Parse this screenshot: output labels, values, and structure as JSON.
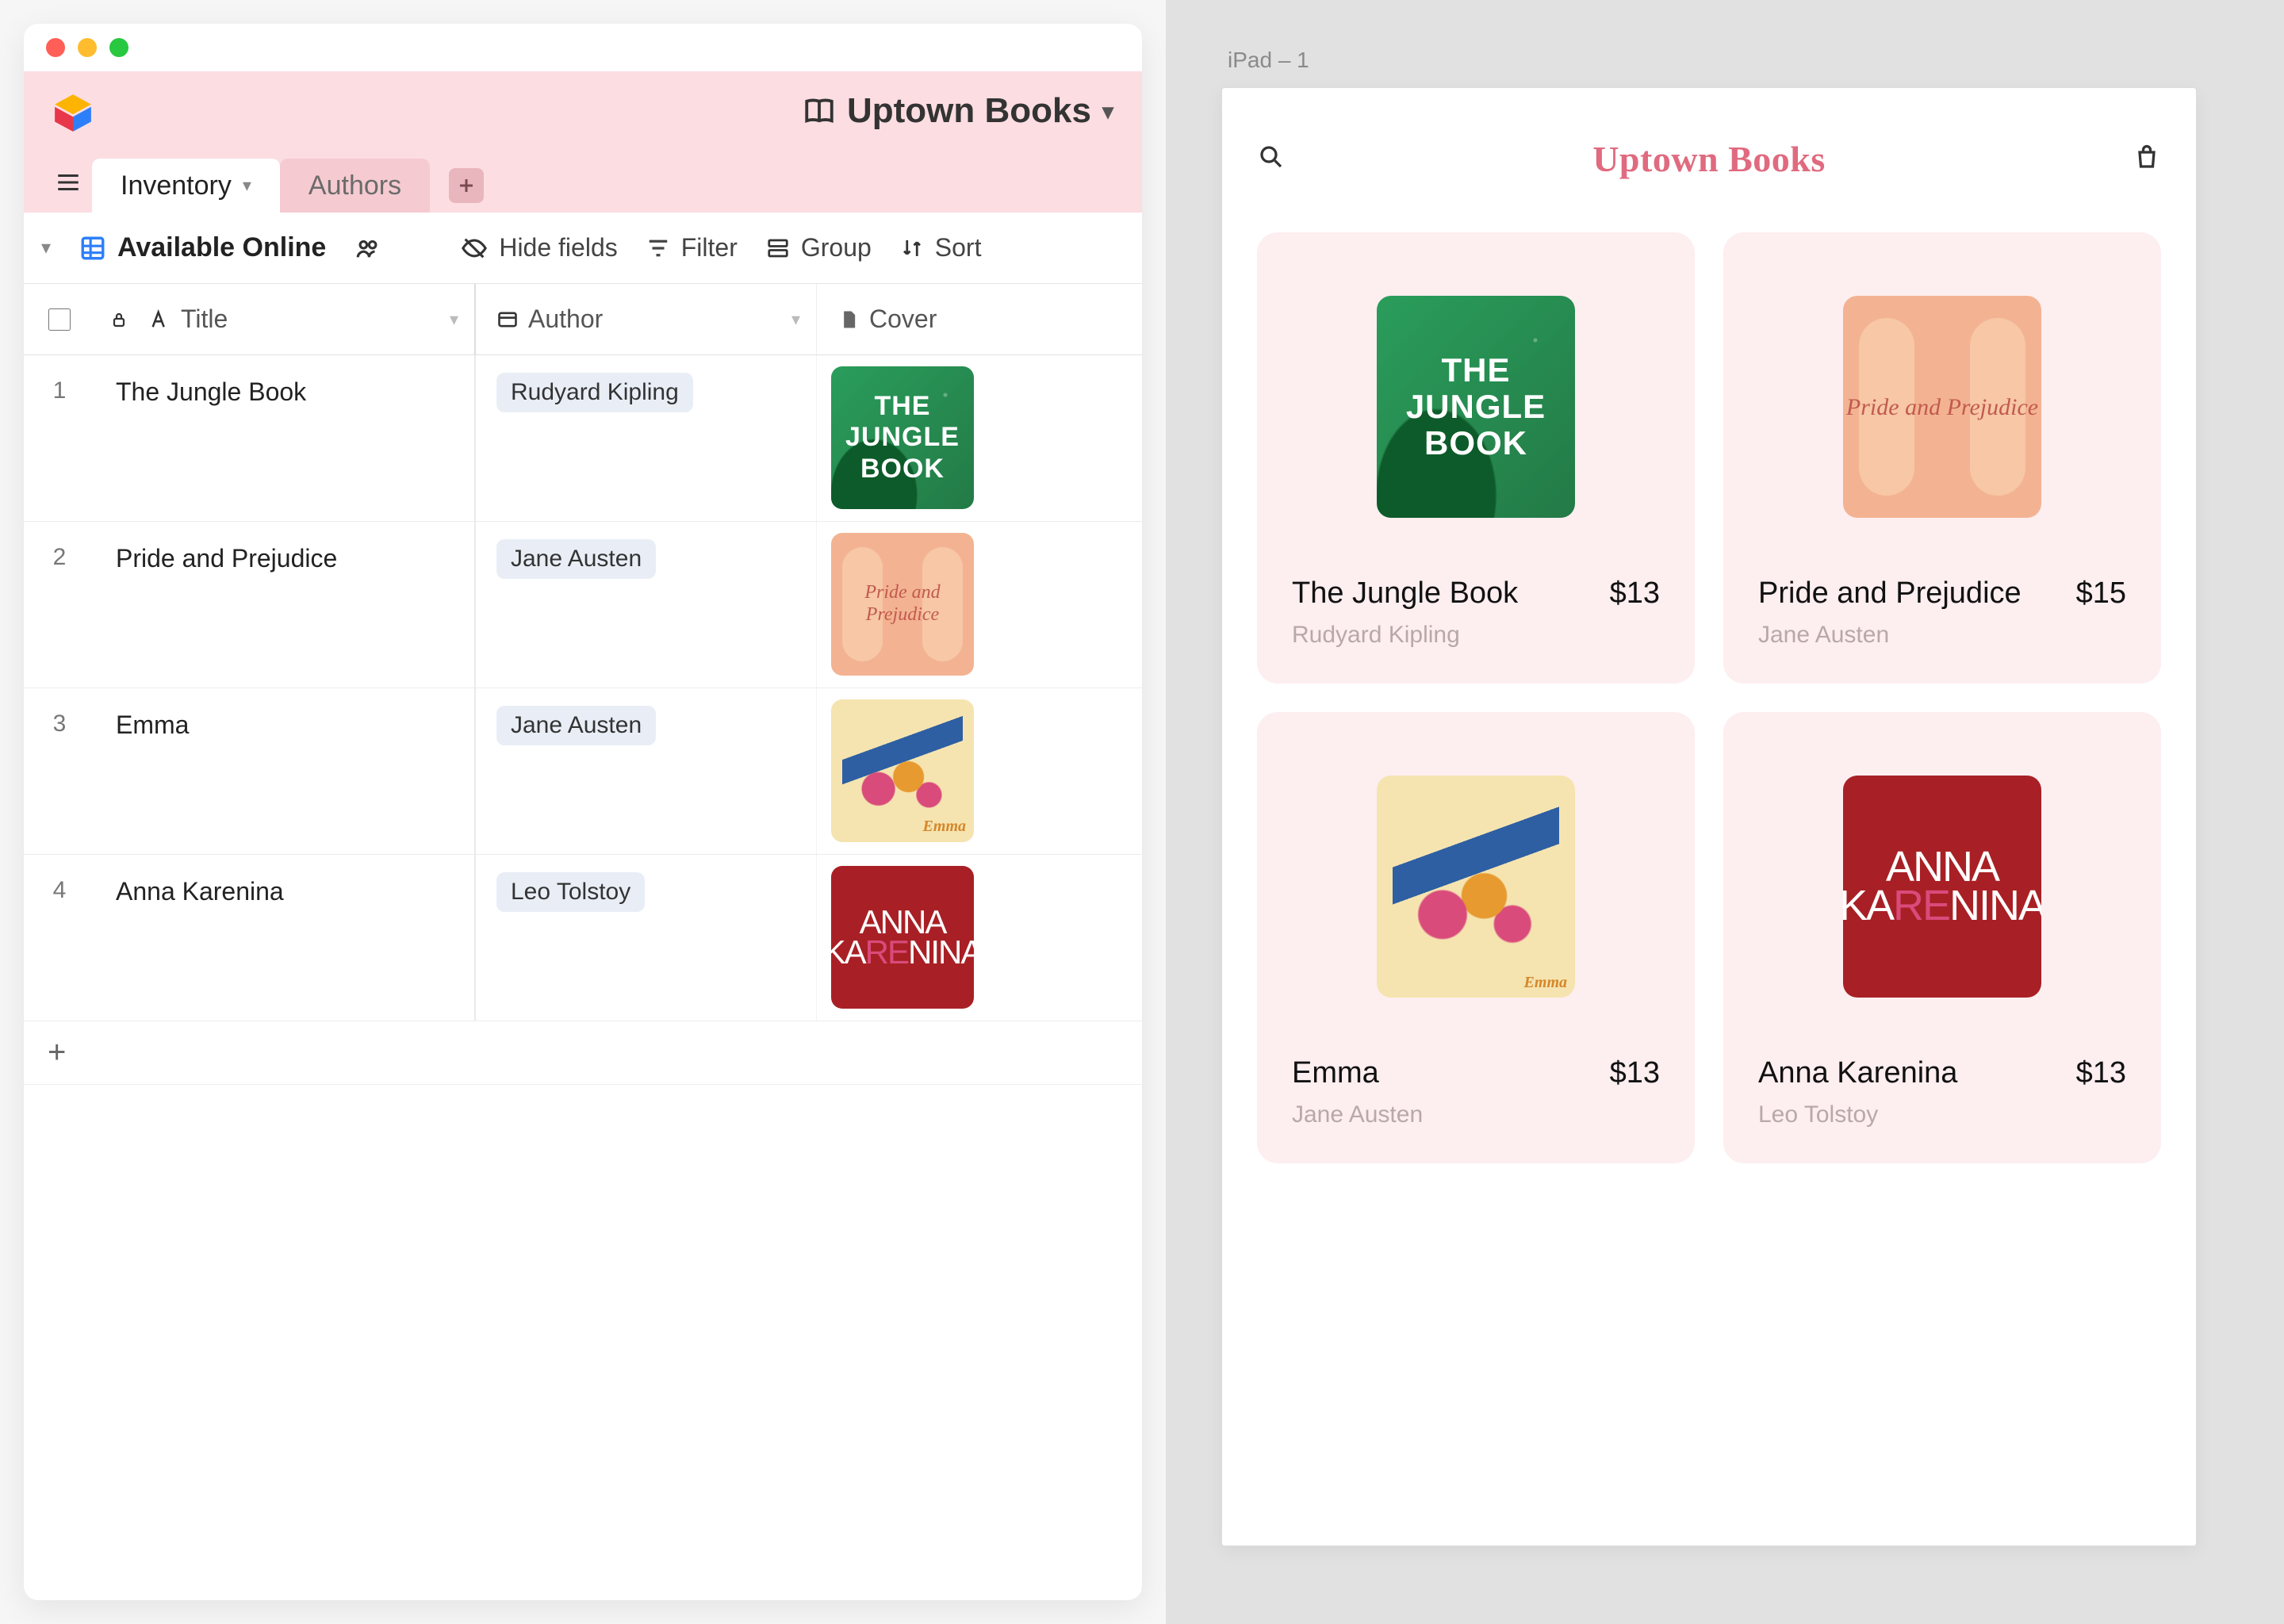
{
  "base": {
    "title": "Uptown Books"
  },
  "tabs": {
    "inventory": "Inventory",
    "authors": "Authors"
  },
  "viewbar": {
    "view_name": "Available Online",
    "hide_fields": "Hide fields",
    "filter": "Filter",
    "group": "Group",
    "sort": "Sort"
  },
  "columns": {
    "title": "Title",
    "author": "Author",
    "cover": "Cover"
  },
  "rows": [
    {
      "n": "1",
      "title": "The Jungle Book",
      "author": "Rudyard Kipling",
      "cover_text": "THE JUNGLE BOOK",
      "cover_style": "cov-jungle"
    },
    {
      "n": "2",
      "title": "Pride and Prejudice",
      "author": "Jane Austen",
      "cover_text": "Pride and Prejudice",
      "cover_style": "cov-pride"
    },
    {
      "n": "3",
      "title": "Emma",
      "author": "Jane Austen",
      "cover_text": "",
      "cover_style": "cov-emma",
      "cover_label": "Emma"
    },
    {
      "n": "4",
      "title": "Anna Karenina",
      "author": "Leo Tolstoy",
      "cover_text": "ANNA KARENINA",
      "cover_style": "cov-anna"
    }
  ],
  "mockup": {
    "frame_label": "iPad – 1",
    "shop_title": "Uptown Books"
  },
  "products": [
    {
      "title": "The Jungle Book",
      "author": "Rudyard Kipling",
      "price": "$13",
      "cover_text": "THE JUNGLE BOOK",
      "cover_style": "cov-jungle"
    },
    {
      "title": "Pride and Prejudice",
      "author": "Jane Austen",
      "price": "$15",
      "cover_text": "Pride and Prejudice",
      "cover_style": "cov-pride"
    },
    {
      "title": "Emma",
      "author": "Jane Austen",
      "price": "$13",
      "cover_text": "",
      "cover_style": "cov-emma",
      "cover_label": "Emma"
    },
    {
      "title": "Anna Karenina",
      "author": "Leo Tolstoy",
      "price": "$13",
      "cover_text": "ANNA KARENINA",
      "cover_style": "cov-anna"
    }
  ]
}
